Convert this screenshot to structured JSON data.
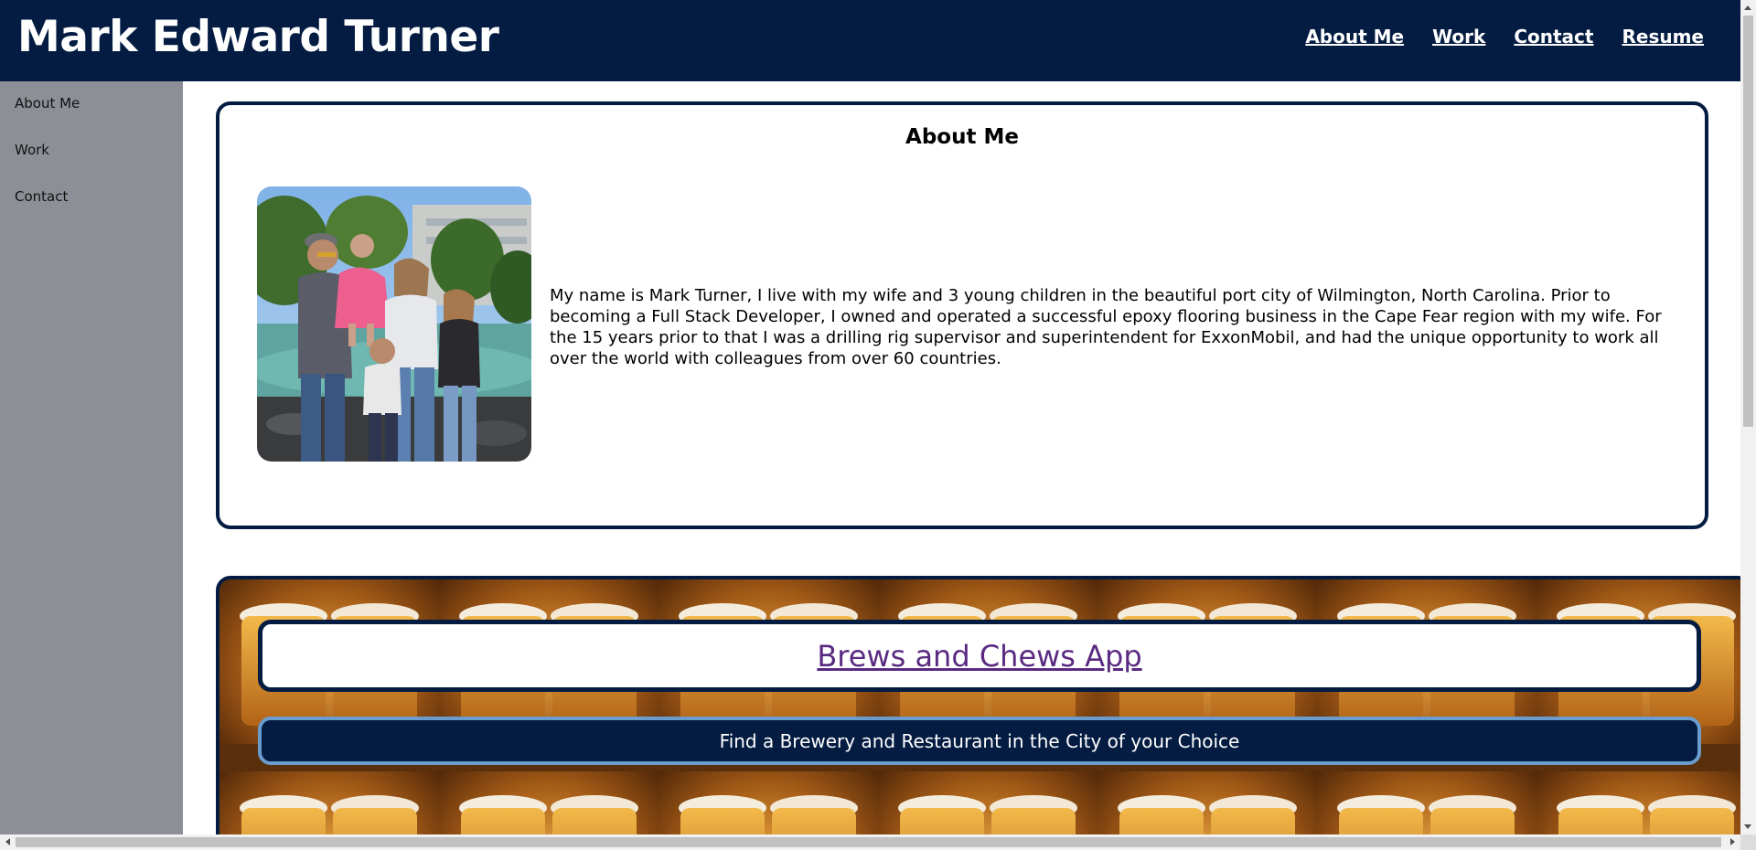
{
  "header": {
    "title": "Mark Edward Turner",
    "nav": [
      {
        "label": "About Me"
      },
      {
        "label": "Work"
      },
      {
        "label": "Contact"
      },
      {
        "label": "Resume"
      }
    ]
  },
  "sidebar": {
    "items": [
      {
        "label": "About Me"
      },
      {
        "label": "Work"
      },
      {
        "label": "Contact"
      }
    ]
  },
  "about": {
    "heading": "About Me",
    "photo_icon": "family-photo",
    "text": "My name is Mark Turner, I live with my wife and 3 young children in the beautiful port city of Wilmington, North Carolina. Prior to becoming a Full Stack Developer, I owned and operated a successful epoxy flooring business in the Cape Fear region with my wife. For the 15 years prior to that I was a drilling rig supervisor and superintendent for ExxonMobil, and had the unique opportunity to work all over the world with colleagues from over 60 countries."
  },
  "projects": [
    {
      "title": "Brews and Chews App",
      "description": "Find a Brewery and Restaurant in the City of your Choice",
      "background_icon": "beer-mugs-pattern"
    }
  ],
  "colors": {
    "header_bg": "#041c42",
    "sidebar_bg": "#8c9096",
    "card_border": "#041c42",
    "link_visited": "#5a2a82",
    "desc_border": "#6a9ccd"
  }
}
